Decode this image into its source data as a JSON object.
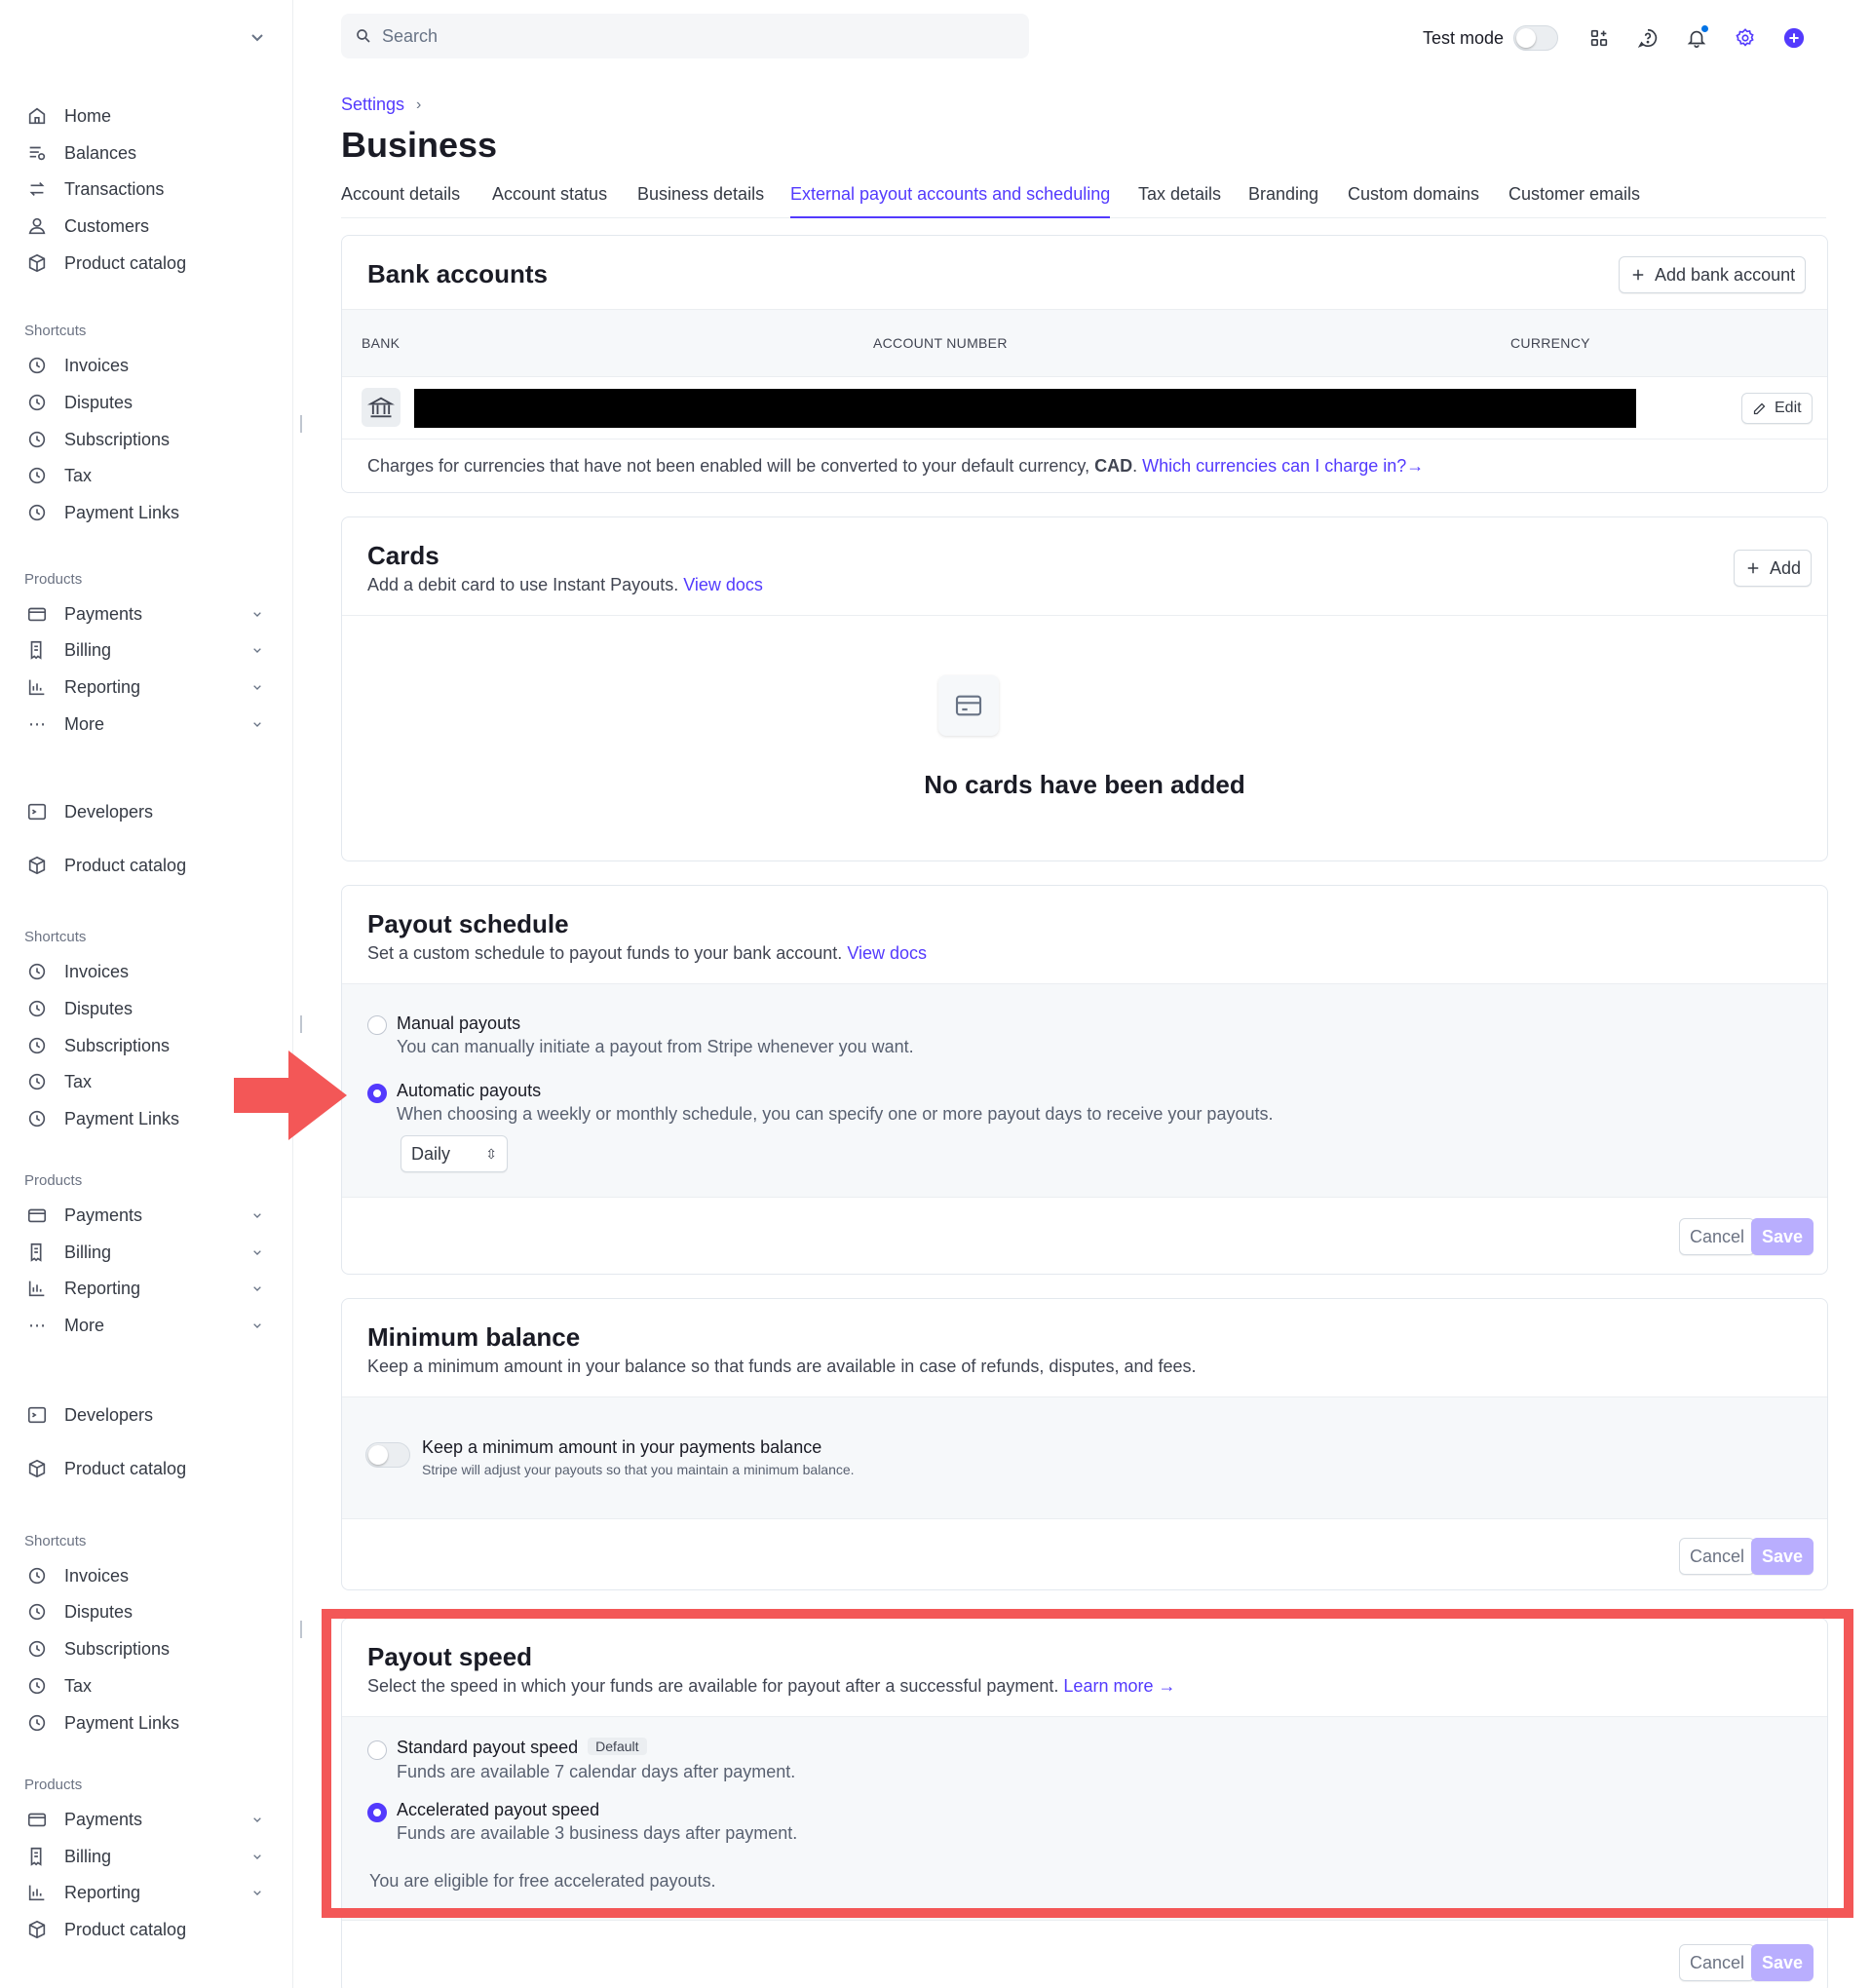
{
  "sidebar": {
    "main_items": [
      "Home",
      "Balances",
      "Transactions",
      "Customers",
      "Product catalog"
    ],
    "section_shortcuts": "Shortcuts",
    "shortcut_items": [
      "Invoices",
      "Disputes",
      "Subscriptions",
      "Tax",
      "Payment Links"
    ],
    "section_products": "Products",
    "product_items": [
      "Payments",
      "Billing",
      "Reporting",
      "More"
    ],
    "product_items_last": [
      "Payments",
      "Billing",
      "Reporting",
      "Product catalog"
    ],
    "developers": "Developers",
    "product_catalog": "Product catalog"
  },
  "topbar": {
    "search_placeholder": "Search",
    "test_mode_label": "Test mode"
  },
  "page": {
    "breadcrumb": "Settings",
    "title": "Business",
    "tabs": [
      "Account details",
      "Account status",
      "Business details",
      "External payout accounts and scheduling",
      "Tax details",
      "Branding",
      "Custom domains",
      "Customer emails"
    ],
    "active_tab": "External payout accounts and scheduling"
  },
  "bank_accounts": {
    "title": "Bank accounts",
    "add_button": "Add bank account",
    "columns": [
      "BANK",
      "ACCOUNT NUMBER",
      "CURRENCY"
    ],
    "edit_button": "Edit",
    "note_prefix": "Charges for currencies that have not been enabled will be converted to your default currency, ",
    "note_currency": "CAD",
    "note_link": "Which currencies can I charge in?"
  },
  "cards": {
    "title": "Cards",
    "subtitle": "Add a debit card to use Instant Payouts.",
    "subtitle_link": "View docs",
    "add_button": "Add",
    "empty_text": "No cards have been added"
  },
  "payout_schedule": {
    "title": "Payout schedule",
    "subtitle": "Set a custom schedule to payout funds to your bank account.",
    "subtitle_link": "View docs",
    "options": [
      {
        "label": "Manual payouts",
        "desc": "You can manually initiate a payout from Stripe whenever you want.",
        "selected": false
      },
      {
        "label": "Automatic payouts",
        "desc": "When choosing a weekly or monthly schedule, you can specify one or more payout days to receive your payouts.",
        "selected": true
      }
    ],
    "frequency": "Daily",
    "cancel": "Cancel",
    "save": "Save"
  },
  "minimum_balance": {
    "title": "Minimum balance",
    "subtitle": "Keep a minimum amount in your balance so that funds are available in case of refunds, disputes, and fees.",
    "toggle_label": "Keep a minimum amount in your payments balance",
    "toggle_desc": "Stripe will adjust your payouts so that you maintain a minimum balance.",
    "cancel": "Cancel",
    "save": "Save"
  },
  "payout_speed": {
    "title": "Payout speed",
    "subtitle": "Select the speed in which your funds are available for payout after a successful payment.",
    "subtitle_link": "Learn more",
    "options": [
      {
        "label": "Standard payout speed",
        "badge": "Default",
        "desc": "Funds are available 7 calendar days after payment.",
        "selected": false
      },
      {
        "label": "Accelerated payout speed",
        "badge": "",
        "desc": "Funds are available 3 business days after payment.",
        "selected": true
      }
    ],
    "eligibility": "You are eligible for free accelerated payouts.",
    "cancel": "Cancel",
    "save": "Save"
  },
  "colors": {
    "accent": "#533afd",
    "annotation_red": "#f35757",
    "save_disabled": "#b9aefe"
  }
}
